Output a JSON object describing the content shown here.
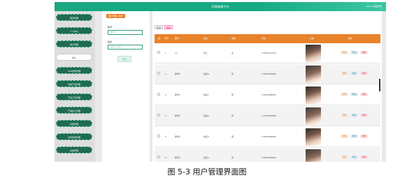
{
  "app": {
    "title": "ZS物联管平台",
    "user": "admin 退出登录"
  },
  "sidebar": {
    "items": [
      {
        "label": "首页管理"
      },
      {
        "label": "个人中心"
      },
      {
        "label": "用户管理"
      },
      {
        "label": "用户",
        "active": true
      },
      {
        "label": "ASO搜索管理"
      },
      {
        "label": "当前产品管理"
      },
      {
        "label": "产品工作管理"
      },
      {
        "label": "产品线上管理"
      },
      {
        "label": "系统管理"
      },
      {
        "label": "文件导出管理"
      },
      {
        "label": "系统管理"
      }
    ]
  },
  "filter": {
    "tab": "用户管理 / 用户",
    "label1": "账号",
    "input1_placeholder": "账号",
    "label2": "姓名",
    "input2_placeholder": "请输入姓名",
    "query_label": "查询"
  },
  "toolbar": {
    "add_label": "新增",
    "delete_label": "删除"
  },
  "table": {
    "headers": {
      "check": "选",
      "index": "序号",
      "account": "账号",
      "name": "姓名",
      "gender": "性别",
      "phone": "手机",
      "avatar": "头像",
      "ops": "操作"
    },
    "rows": [
      {
        "index": "1",
        "account": "11",
        "name": "张三",
        "gender": "女",
        "phone": "17682222222"
      },
      {
        "index": "2",
        "account": "账号8",
        "name": "姓名8",
        "gender": "男",
        "phone": "13823888888"
      },
      {
        "index": "3",
        "account": "账号7",
        "name": "姓名7",
        "gender": "男",
        "phone": "13823888887"
      },
      {
        "index": "4",
        "account": "账号6",
        "name": "姓名6",
        "gender": "男",
        "phone": "13823888886"
      },
      {
        "index": "5",
        "account": "账号5",
        "name": "姓名5",
        "gender": "男",
        "phone": "13823888885"
      },
      {
        "index": "6",
        "account": "账号4",
        "name": "姓名4",
        "gender": "男",
        "phone": "13823888884"
      }
    ],
    "op_labels": {
      "detail": "详情",
      "edit": "修改",
      "delete": "删除"
    }
  },
  "caption": "图 5-3 用户管理界面图"
}
